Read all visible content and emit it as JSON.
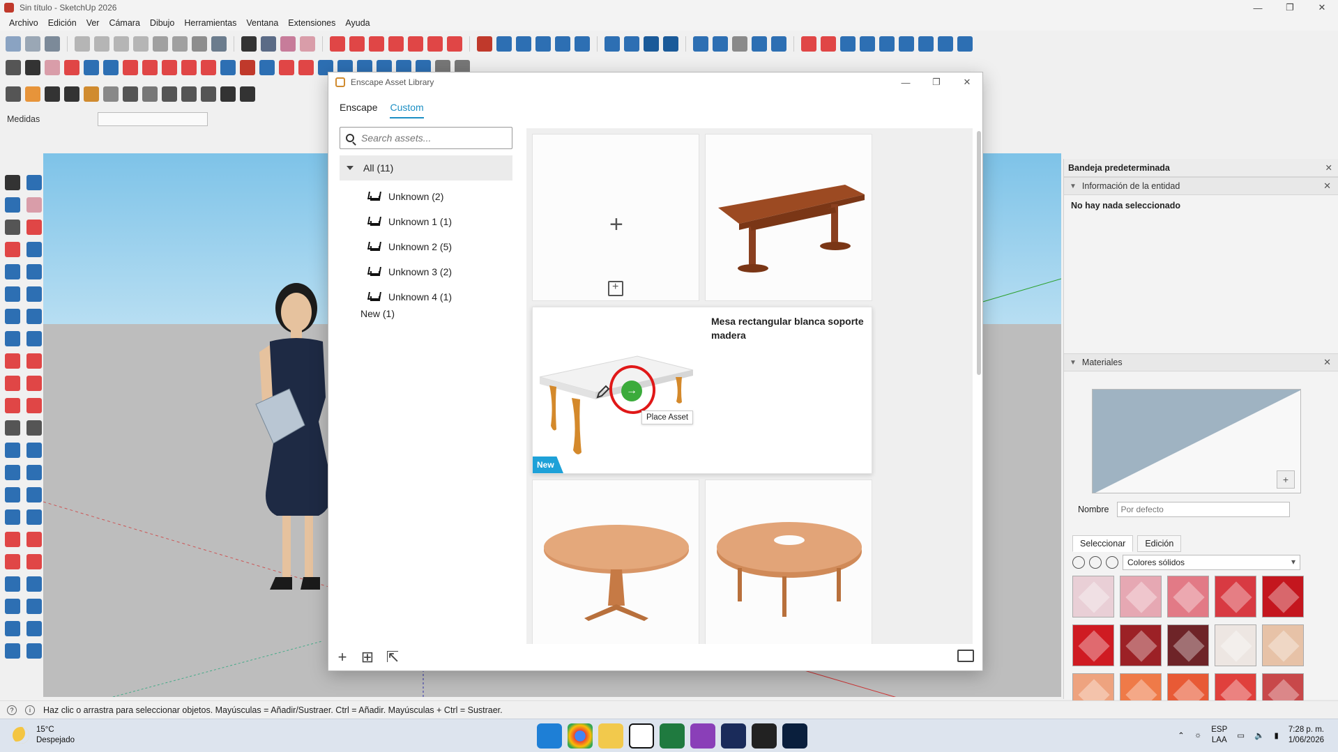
{
  "window": {
    "title": "Sin título - SketchUp 2026",
    "controls": [
      "—",
      "❐",
      "✕"
    ]
  },
  "menu": [
    "Archivo",
    "Edición",
    "Ver",
    "Cámara",
    "Dibujo",
    "Herramientas",
    "Ventana",
    "Extensiones",
    "Ayuda"
  ],
  "measurements_label": "Medidas",
  "dialog": {
    "title": "Enscape Asset Library",
    "tabs": [
      "Enscape",
      "Custom"
    ],
    "active_tab": "Custom",
    "search_placeholder": "Search assets...",
    "categories": {
      "all_label": "All (11)",
      "items": [
        "Unknown (2)",
        "Unknown 1 (1)",
        "Unknown 2 (5)",
        "Unknown 3 (2)",
        "Unknown 4 (1)"
      ],
      "new_label": "New (1)"
    },
    "selected_asset": {
      "title": "Mesa rectangular blanca soporte madera",
      "badge": "New",
      "tooltip": "Place Asset"
    }
  },
  "tray": {
    "title": "Bandeja predeterminada",
    "entity_section": "Información de la entidad",
    "entity_empty": "No hay nada seleccionado",
    "materials_section": "Materiales",
    "name_label": "Nombre",
    "name_placeholder": "Por defecto",
    "tabs": [
      "Seleccionar",
      "Edición"
    ],
    "library": "Colores sólidos",
    "swatch_colors": [
      "#e9cfd6",
      "#e6a8b3",
      "#e27a86",
      "#d83a42",
      "#c4161e",
      "#cf1b22",
      "#9c2126",
      "#6e2428",
      "#ede6e2",
      "#e7c2a7",
      "#eea37f",
      "#ef7a48",
      "#e85a35",
      "#e0403c",
      "#c8484a"
    ]
  },
  "status": {
    "message": "Haz clic o arrastra para seleccionar objetos. Mayúsculas = Añadir/Sustraer. Ctrl = Añadir. Mayúsculas + Ctrl = Sustraer."
  },
  "taskbar": {
    "weather_temp": "15°C",
    "weather_desc": "Despejado",
    "lang_top": "ESP",
    "lang_bottom": "LAA",
    "time": "7:28 p. m.",
    "date": "1/06/2026"
  }
}
